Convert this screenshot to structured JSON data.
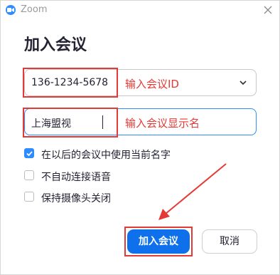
{
  "window": {
    "title": "Zoom"
  },
  "page": {
    "heading": "加入会议"
  },
  "meeting_id": {
    "value": "136-1234-5678",
    "annotation": "输入会议ID"
  },
  "display_name": {
    "value": "上海盟视",
    "annotation": "输入会议显示名"
  },
  "options": [
    {
      "label": "在以后的会议中使用当前名字",
      "checked": true
    },
    {
      "label": "不自动连接语音",
      "checked": false
    },
    {
      "label": "保持摄像头关闭",
      "checked": false
    }
  ],
  "buttons": {
    "join": "加入会议",
    "cancel": "取消"
  },
  "colors": {
    "accent": "#0e71eb",
    "annotation": "#e53935",
    "focus_border": "#2d8cff"
  },
  "icons": {
    "app": "zoom-camera-icon",
    "close": "close-icon",
    "dropdown": "chevron-down-icon",
    "check": "check-icon",
    "arrow": "arrow-icon"
  }
}
